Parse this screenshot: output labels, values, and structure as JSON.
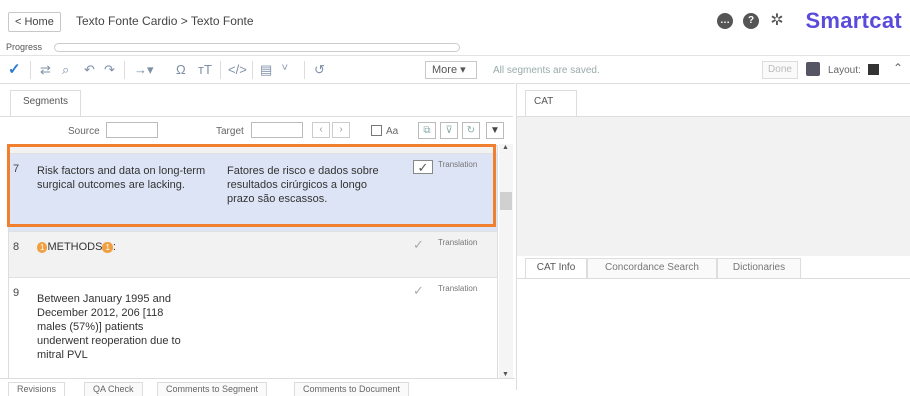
{
  "header": {
    "home_label": "< Home",
    "breadcrumb": "Texto Fonte Cardio > Texto Fonte",
    "brand": "Smartcat",
    "icons": [
      "chat-icon",
      "help-icon",
      "gear-icon"
    ]
  },
  "progress": {
    "label": "Progress",
    "value": 0
  },
  "toolbar": {
    "more_label": "More  ▾",
    "saved_text": "All segments are saved.",
    "done_label": "Done",
    "layout_label": "Layout:"
  },
  "segments_panel": {
    "tab_label": "Segments",
    "source_label": "Source",
    "target_label": "Target",
    "aa_label": "Aa"
  },
  "rows": [
    {
      "num": "7",
      "source": "Risk factors and data on long-term surgical outcomes are lacking.",
      "target": "Fatores de risco e dados sobre resultados cirúrgicos a longo prazo são escassos.",
      "status": "Translation"
    },
    {
      "num": "8",
      "source_tag_open": "1",
      "source": "METHODS",
      "source_tag_close": "1",
      "source_suffix": ":",
      "target": "",
      "status": "Translation"
    },
    {
      "num": "9",
      "source": "Between January 1995 and December 2012, 206 [118 males (57%)] patients underwent reoperation due to mitral PVL",
      "target": "",
      "status": "Translation"
    }
  ],
  "bottom_tabs": [
    "Revisions",
    "QA Check",
    "Comments to Segment",
    "Comments to Document"
  ],
  "right_panel": {
    "cat_tab": "CAT",
    "info_tabs": [
      "CAT Info",
      "Concordance Search",
      "Dictionaries"
    ]
  },
  "colors": {
    "brand": "#5a4bdc",
    "highlight": "#f08030",
    "accent": "#2a7bd3",
    "tag": "#f0a040"
  }
}
